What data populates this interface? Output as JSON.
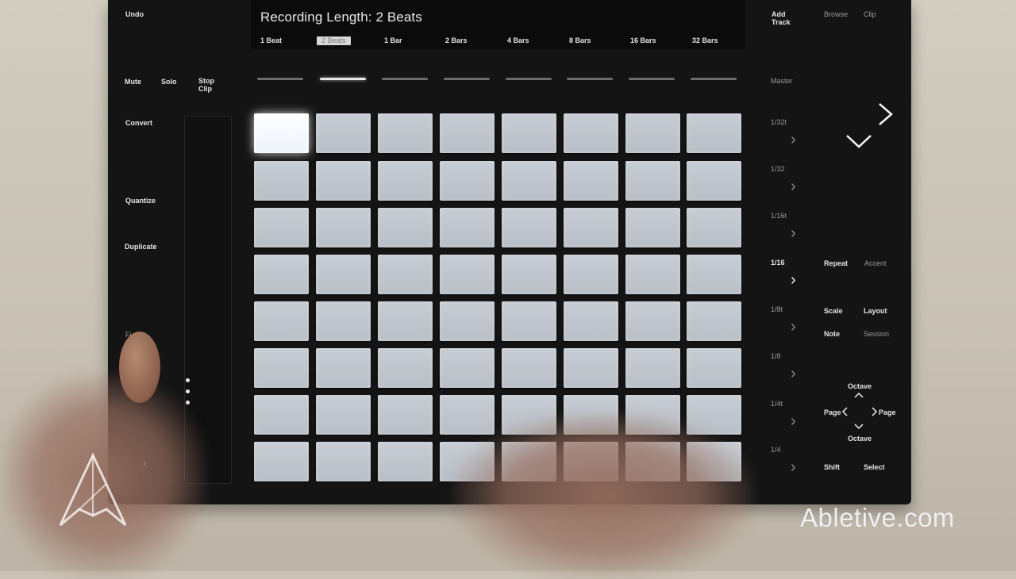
{
  "display": {
    "title": "Recording Length: 2 Beats",
    "options": [
      {
        "label": "1 Beat",
        "selected": false
      },
      {
        "label": "2 Beats",
        "selected": true
      },
      {
        "label": "1 Bar",
        "selected": false
      },
      {
        "label": "2 Bars",
        "selected": false
      },
      {
        "label": "4 Bars",
        "selected": false
      },
      {
        "label": "8 Bars",
        "selected": false
      },
      {
        "label": "16 Bars",
        "selected": false
      },
      {
        "label": "32 Bars",
        "selected": false
      }
    ]
  },
  "left_buttons": {
    "undo": "Undo",
    "mute": "Mute",
    "solo": "Solo",
    "stop_clip": "Stop\nClip",
    "convert": "Convert",
    "quantize": "Quantize",
    "duplicate": "Duplicate",
    "fixed": "Fi..."
  },
  "top_right_buttons": {
    "add_track": "Add\nTrack",
    "browse": "Browse",
    "clip": "Clip",
    "master": "Master"
  },
  "scene_buttons": [
    "1/32t",
    "1/32",
    "1/16t",
    "1/16",
    "1/8t",
    "1/8",
    "1/4t",
    "1/4"
  ],
  "scene_active": "1/16",
  "right_buttons": {
    "repeat": "Repeat",
    "accent": "Accent",
    "scale": "Scale",
    "layout": "Layout",
    "note": "Note",
    "session": "Session",
    "octave_up": "Octave",
    "octave_down": "Octave",
    "page_left": "Page",
    "page_right": "Page",
    "shift": "Shift",
    "select": "Select"
  },
  "pads": {
    "rows": 8,
    "cols": 8,
    "lit_pad": "row 1, col 1"
  },
  "watermark": "Abletive.com",
  "colors": {
    "pad": "#c0c6cd",
    "pad_lit": "#ffffff",
    "device": "#141414"
  }
}
